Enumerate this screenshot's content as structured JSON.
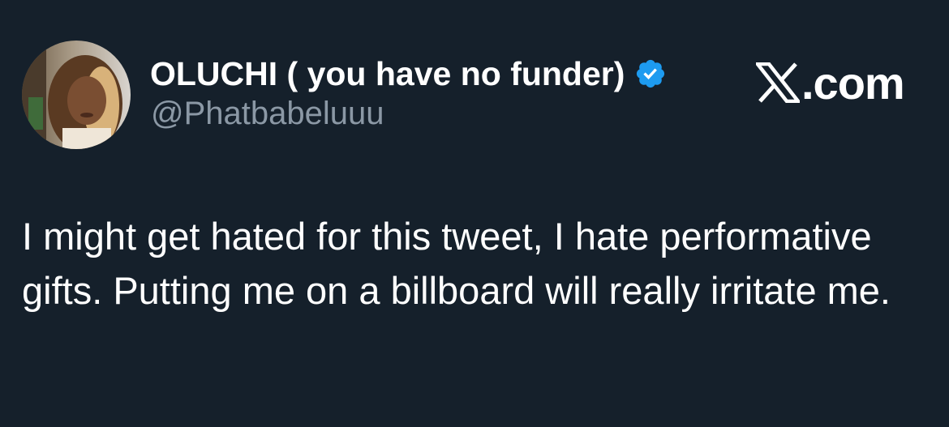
{
  "author": {
    "display_name": "OLUCHI ( you have no funder)",
    "handle": "@Phatbabeluuu",
    "verified_color": "#1d9bf0",
    "avatar_icon": "profile-photo"
  },
  "brand": {
    "logo_icon": "x-logo-icon",
    "domain": ".com"
  },
  "tweet": {
    "text": "I might get hated for this tweet, I hate performative gifts. Putting me on a billboard will really irritate me."
  },
  "colors": {
    "background": "#15202b",
    "text_primary": "#ffffff",
    "text_secondary": "#8b98a5",
    "accent": "#1d9bf0"
  }
}
